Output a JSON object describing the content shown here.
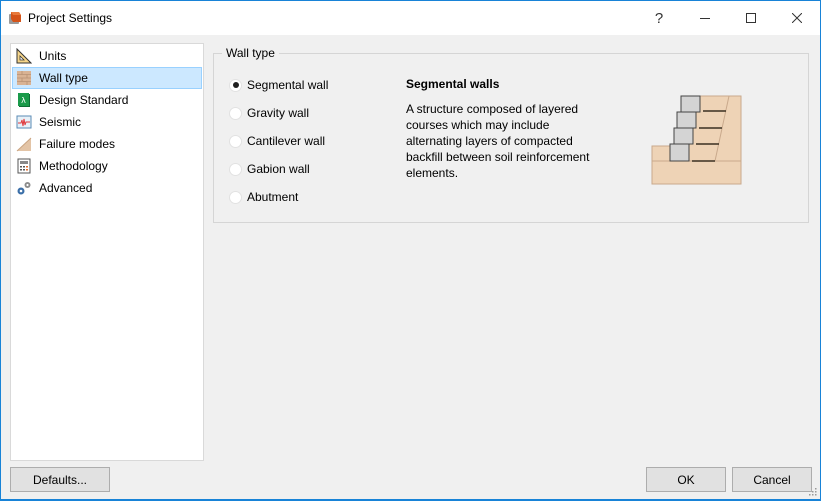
{
  "window": {
    "title": "Project Settings",
    "app_icon": "project-settings-app-icon",
    "controls": {
      "help": "?",
      "minimize": "minimize",
      "maximize": "maximize",
      "close": "close"
    }
  },
  "sidebar": {
    "items": [
      {
        "label": "Units",
        "icon": "set-square-icon",
        "selected": false
      },
      {
        "label": "Wall type",
        "icon": "brick-wall-icon",
        "selected": true
      },
      {
        "label": "Design Standard",
        "icon": "design-standard-book-icon",
        "selected": false
      },
      {
        "label": "Seismic",
        "icon": "seismograph-icon",
        "selected": false
      },
      {
        "label": "Failure modes",
        "icon": "slope-icon",
        "selected": false
      },
      {
        "label": "Methodology",
        "icon": "calculator-icon",
        "selected": false
      },
      {
        "label": "Advanced",
        "icon": "gears-icon",
        "selected": false
      }
    ]
  },
  "wall_type": {
    "group_label": "Wall type",
    "options": [
      {
        "label": "Segmental wall",
        "checked": true
      },
      {
        "label": "Gravity wall",
        "checked": false
      },
      {
        "label": "Cantilever wall",
        "checked": false
      },
      {
        "label": "Gabion wall",
        "checked": false
      },
      {
        "label": "Abutment",
        "checked": false
      }
    ],
    "description": {
      "title": "Segmental walls",
      "text": "A structure composed of layered courses which may include alternating layers of compacted backfill between soil reinforcement elements."
    },
    "illustration": "segmental-wall-diagram"
  },
  "footer": {
    "defaults_label": "Defaults...",
    "ok_label": "OK",
    "cancel_label": "Cancel"
  },
  "colors": {
    "accent_border": "#1883d7",
    "selection_bg": "#cce8ff",
    "selection_border": "#99d1ff",
    "soil": "#eed3b6",
    "block": "#d4d4d4"
  }
}
